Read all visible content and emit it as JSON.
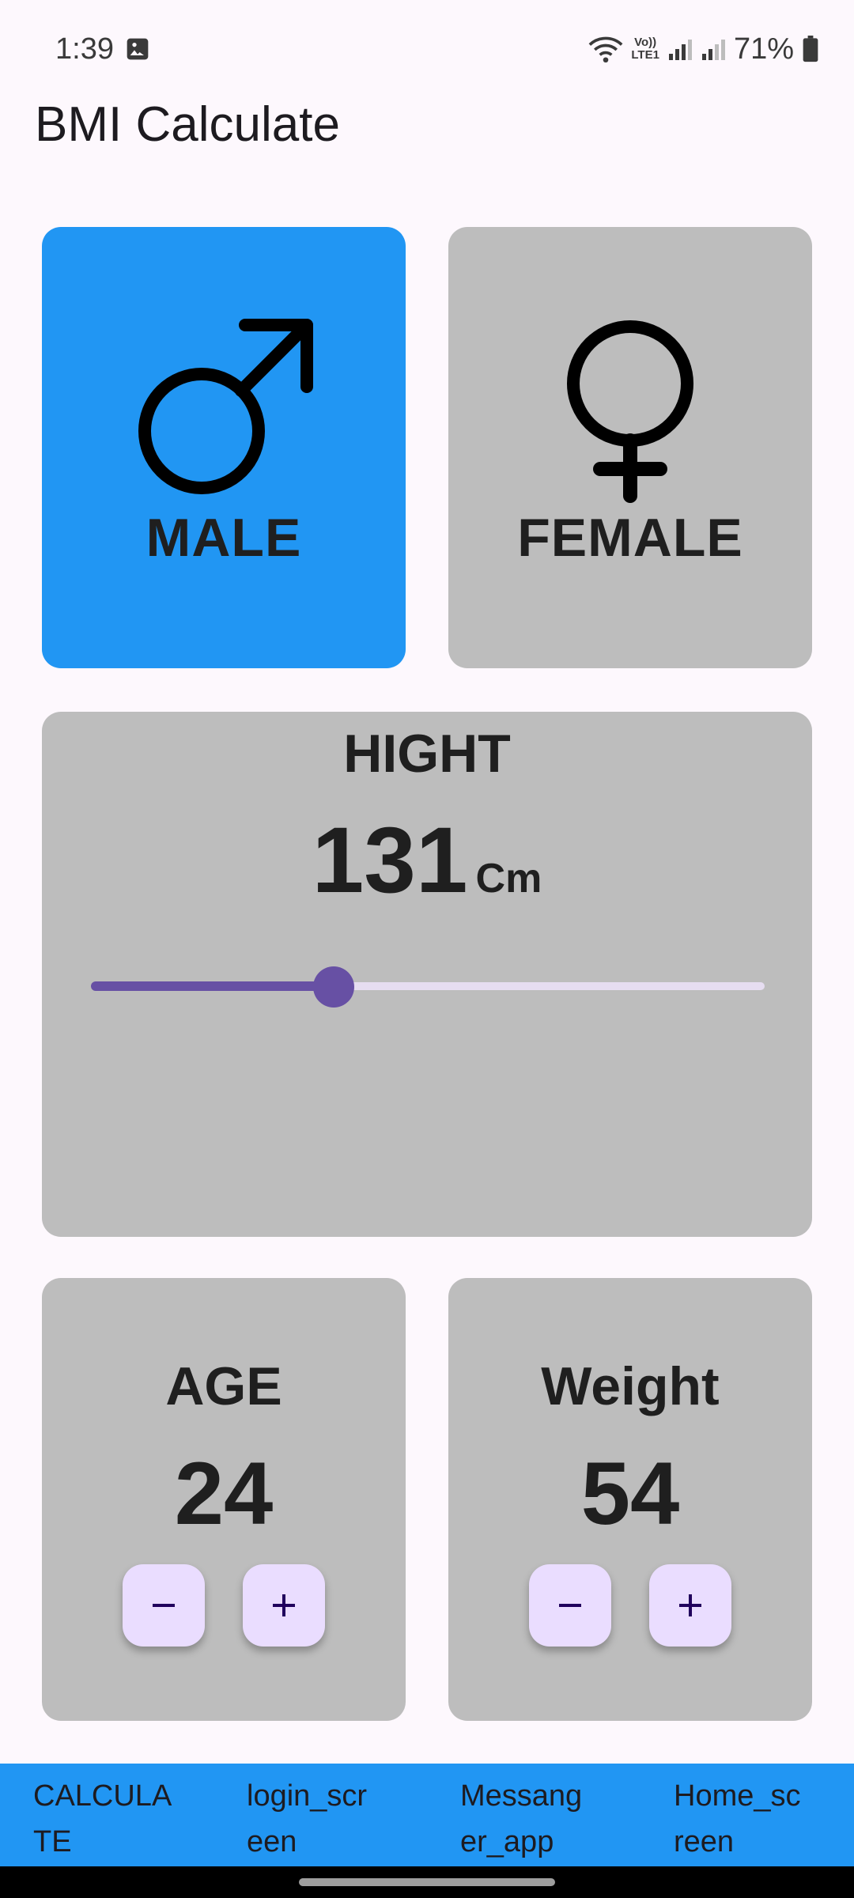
{
  "status_bar": {
    "time": "1:39",
    "battery": "71%",
    "icons": [
      "image-icon",
      "wifi-icon",
      "volte-icon",
      "signal-icon",
      "signal-icon",
      "battery-icon"
    ],
    "volte_label_top": "Vo))",
    "volte_label_bottom": "LTE1"
  },
  "app_bar": {
    "title": "BMI Calculate"
  },
  "gender": {
    "male_label": "MALE",
    "female_label": "FEMALE",
    "selected": "male",
    "selected_color": "#2196f3",
    "unselected_color": "#bdbdbd"
  },
  "height": {
    "title": "HIGHT",
    "value": "131",
    "unit": "Cm",
    "slider_fraction": 0.36,
    "accent_color": "#6750a4"
  },
  "age": {
    "title": "AGE",
    "value": "24",
    "minus_icon": "minus-icon",
    "plus_icon": "plus-icon"
  },
  "weight": {
    "title": "Weight",
    "value": "54",
    "minus_icon": "minus-icon",
    "plus_icon": "plus-icon"
  },
  "bottom_tabs": [
    {
      "line1": "CALCULA",
      "line2": "TE"
    },
    {
      "line1": "login_scr",
      "line2": "een"
    },
    {
      "line1": "Messang",
      "line2": "er_app"
    },
    {
      "line1": "Home_sc",
      "line2": "reen"
    }
  ],
  "bottom_bar_color": "#2196f3"
}
